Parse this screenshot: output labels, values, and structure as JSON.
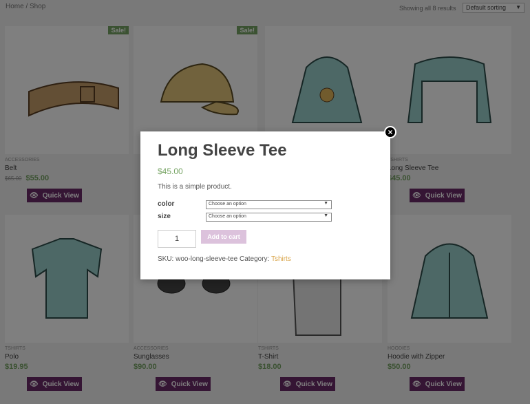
{
  "topbar": {
    "breadcrumb": "Home / Shop",
    "result_count": "Showing all 8 results",
    "sorting": "Default sorting"
  },
  "products": [
    {
      "category": "ACCESSORIES",
      "title": "Belt",
      "old_price": "$65.00",
      "price": "$55.00",
      "sale": "Sale!",
      "quick_view": "Quick View"
    },
    {
      "category": "",
      "title": "",
      "price": "",
      "sale": "Sale!",
      "quick_view": ""
    },
    {
      "category": "",
      "title": "",
      "price": "",
      "quick_view": ""
    },
    {
      "category": "TSHIRTS",
      "title": "Long Sleeve Tee",
      "price": "$45.00",
      "quick_view": "Quick View"
    },
    {
      "category": "TSHIRTS",
      "title": "Polo",
      "price": "$19.95",
      "quick_view": "Quick View"
    },
    {
      "category": "ACCESSORIES",
      "title": "Sunglasses",
      "price": "$90.00",
      "quick_view": "Quick View"
    },
    {
      "category": "TSHIRTS",
      "title": "T-Shirt",
      "price": "$18.00",
      "quick_view": "Quick View"
    },
    {
      "category": "HOODIES",
      "title": "Hoodie with Zipper",
      "price": "$50.00",
      "quick_view": "Quick View"
    }
  ],
  "modal": {
    "title": "Long Sleeve Tee",
    "price": "$45.00",
    "description": "This is a simple product.",
    "color_label": "color",
    "size_label": "size",
    "color_select": "Choose an option",
    "size_select": "Choose an option",
    "quantity": "1",
    "add_to_cart": "Add to cart",
    "sku_label": "SKU:",
    "sku": "woo-long-sleeve-tee",
    "category_label": "Category:",
    "category": "Tshirts",
    "close": "×"
  },
  "colors": {
    "accent": "#6b2a69",
    "price_green": "#77a464",
    "link_gold": "#d9a54a"
  }
}
